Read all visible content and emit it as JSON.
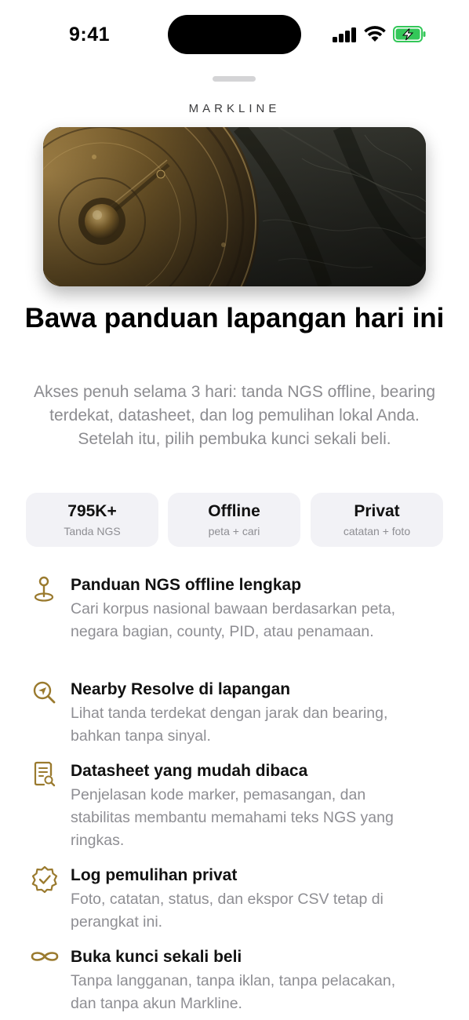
{
  "status_bar": {
    "time": "9:41"
  },
  "brand": "MARKLINE",
  "headline": "Bawa panduan lapangan hari ini",
  "subtext": "Akses penuh selama 3 hari: tanda NGS offline, bearing terdekat, datasheet, dan log pemulihan lokal Anda. Setelah itu, pilih pembuka kunci sekali beli.",
  "stats": [
    {
      "value": "795K+",
      "label": "Tanda NGS"
    },
    {
      "value": "Offline",
      "label": "peta + cari"
    },
    {
      "value": "Privat",
      "label": "catatan + foto"
    }
  ],
  "features": [
    {
      "icon": "map-pin-icon",
      "title": "Panduan NGS offline lengkap",
      "desc": "Cari korpus nasional bawaan berdasarkan peta, negara bagian, county, PID, atau penamaan."
    },
    {
      "icon": "location-search-icon",
      "title": "Nearby Resolve di lapangan",
      "desc": "Lihat tanda terdekat dengan jarak dan bearing, bahkan tanpa sinyal."
    },
    {
      "icon": "document-search-icon",
      "title": "Datasheet yang mudah dibaca",
      "desc": "Penjelasan kode marker, pemasangan, dan stabilitas membantu memahami teks NGS yang ringkas."
    },
    {
      "icon": "verified-badge-icon",
      "title": "Log pemulihan privat",
      "desc": "Foto, catatan, status, dan ekspor CSV tetap di perangkat ini."
    },
    {
      "icon": "infinity-icon",
      "title": "Buka kunci sekali beli",
      "desc": "Tanpa langganan, tanpa iklan, tanpa pelacakan, dan tanpa akun Markline."
    }
  ],
  "colors": {
    "accent": "#9a7a2e",
    "battery": "#34c759",
    "card": "#f2f2f6",
    "muted": "#8e8e93"
  }
}
